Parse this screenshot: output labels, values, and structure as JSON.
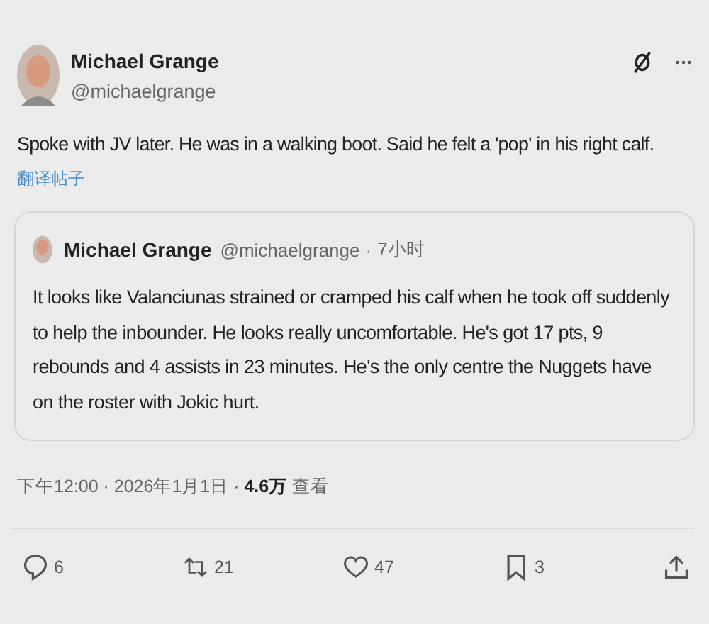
{
  "post": {
    "author": {
      "name": "Michael Grange",
      "handle": "@michaelgrange"
    },
    "text": "Spoke with JV later. He was in a walking boot. Said he felt a 'pop' in his right calf.",
    "translate_link": "翻译帖子",
    "quoted_post": {
      "name": "Michael Grange",
      "handle": "@michaelgrange",
      "separator": "·",
      "time": "7小时",
      "text": "It looks like Valanciunas strained or cramped his calf when he took off suddenly to help the inbounder. He looks really uncomfortable. He's got 17 pts, 9 rebounds and 4 assists in 23 minutes. He's the only centre the Nuggets have on the roster with Jokic hurt."
    },
    "meta": "下午12:00 · 2026年1月1日 · **4.6万** 查看",
    "actions": [
      {
        "kind": "reply",
        "count": "6"
      },
      {
        "kind": "repost",
        "count": "21"
      },
      {
        "kind": "like",
        "count": "47"
      },
      {
        "kind": "bookmark",
        "count": "3"
      },
      {
        "kind": "share"
      }
    ]
  }
}
